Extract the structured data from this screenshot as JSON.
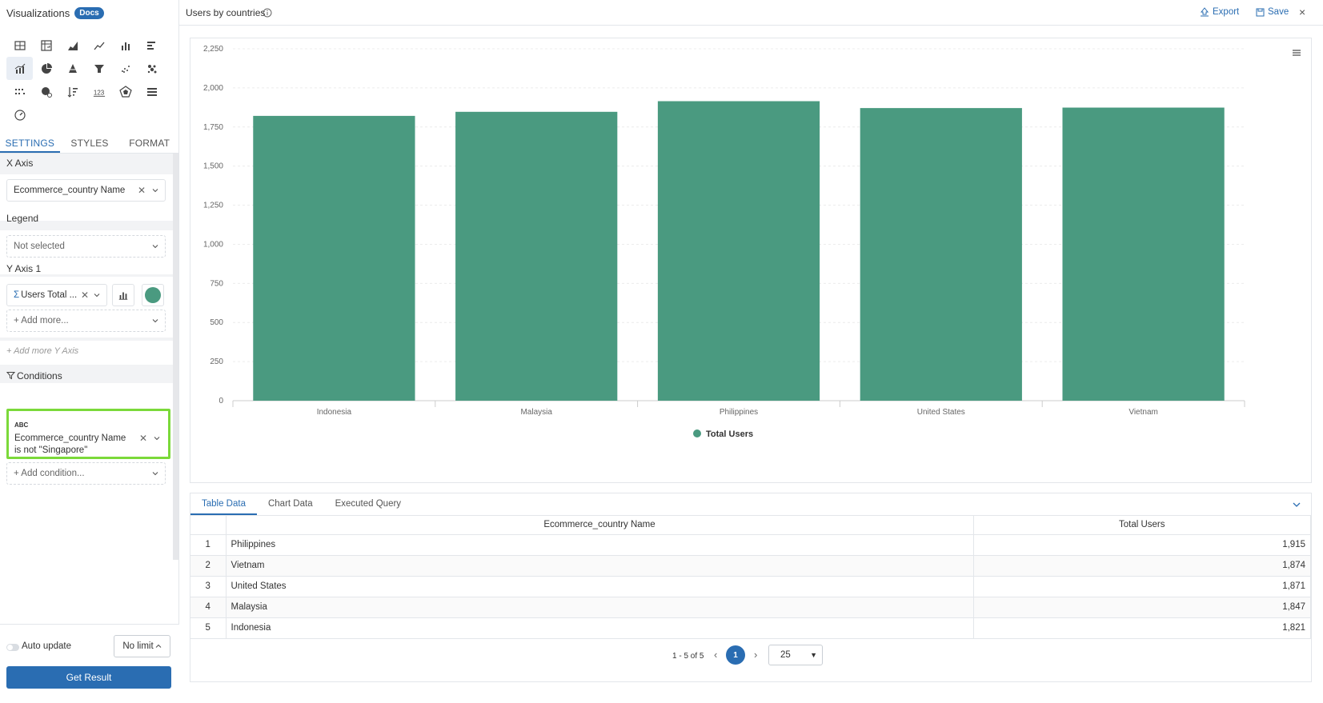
{
  "sidebar": {
    "title": "Visualizations",
    "docs_badge": "Docs",
    "tabs": [
      {
        "label": "SETTINGS"
      },
      {
        "label": "STYLES"
      },
      {
        "label": "FORMAT"
      }
    ],
    "x_axis": {
      "label": "X Axis",
      "value": "Ecommerce_country Name"
    },
    "legend": {
      "label": "Legend",
      "value": "Not selected"
    },
    "y_axis": {
      "label": "Y Axis 1",
      "value": "Users Total ...",
      "add_more": "+ Add more...",
      "add_y_axis": "+ Add more Y Axis",
      "series_color": "#4a9a80"
    },
    "conditions": {
      "label": "Conditions",
      "type_tag": "ABC",
      "condition_text": "Ecommerce_country Name is not \"Singapore\"",
      "add_condition": "+ Add condition..."
    },
    "footer": {
      "auto_update": "Auto update",
      "limit": "No limit",
      "get_result": "Get Result"
    }
  },
  "header": {
    "title": "Users by countries",
    "export_label": "Export",
    "save_label": "Save",
    "close": "×"
  },
  "chart_data": {
    "type": "bar",
    "categories": [
      "Indonesia",
      "Malaysia",
      "Philippines",
      "United States",
      "Vietnam"
    ],
    "series": [
      {
        "name": "Total Users",
        "values": [
          1821,
          1847,
          1915,
          1871,
          1874
        ],
        "color": "#4a9a80"
      }
    ],
    "ylim": [
      0,
      2250
    ],
    "yticks": [
      0,
      250,
      500,
      750,
      1000,
      1250,
      1500,
      1750,
      2000,
      2250
    ],
    "ytick_labels": [
      "0",
      "250",
      "500",
      "750",
      "1,000",
      "1,250",
      "1,500",
      "1,750",
      "2,000",
      "2,250"
    ],
    "grid": true,
    "legend_position": "bottom-center"
  },
  "table": {
    "tabs": [
      "Table Data",
      "Chart Data",
      "Executed Query"
    ],
    "columns": [
      "Ecommerce_country Name",
      "Total Users"
    ],
    "rows": [
      {
        "idx": "1",
        "name": "Philippines",
        "value": "1,915"
      },
      {
        "idx": "2",
        "name": "Vietnam",
        "value": "1,874"
      },
      {
        "idx": "3",
        "name": "United States",
        "value": "1,871"
      },
      {
        "idx": "4",
        "name": "Malaysia",
        "value": "1,847"
      },
      {
        "idx": "5",
        "name": "Indonesia",
        "value": "1,821"
      }
    ],
    "pagination": {
      "range": "1 - 5 of 5",
      "current": "1",
      "page_size": "25"
    }
  }
}
